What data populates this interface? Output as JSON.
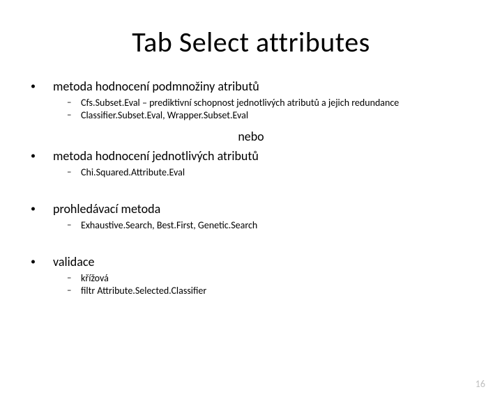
{
  "title": "Tab Select attributes",
  "nebo": "nebo",
  "bullets": {
    "b1": {
      "text": "metoda hodnocení podmnožiny atributů",
      "subs": {
        "s1": "Cfs.Subset.Eval – prediktivní schopnost jednotlivých atributů a jejich redundance",
        "s2": "Classifier.Subset.Eval, Wrapper.Subset.Eval"
      }
    },
    "b2": {
      "text": "metoda hodnocení jednotlivých atributů",
      "subs": {
        "s1": "Chi.Squared.Attribute.Eval"
      }
    },
    "b3": {
      "text": "prohledávací metoda",
      "subs": {
        "s1": "Exhaustive.Search, Best.First, Genetic.Search"
      }
    },
    "b4": {
      "text": "validace",
      "subs": {
        "s1": "křížová",
        "s2": "filtr Attribute.Selected.Classifier"
      }
    }
  },
  "page_number": "16",
  "glyphs": {
    "dot": "•",
    "dash": "–"
  }
}
